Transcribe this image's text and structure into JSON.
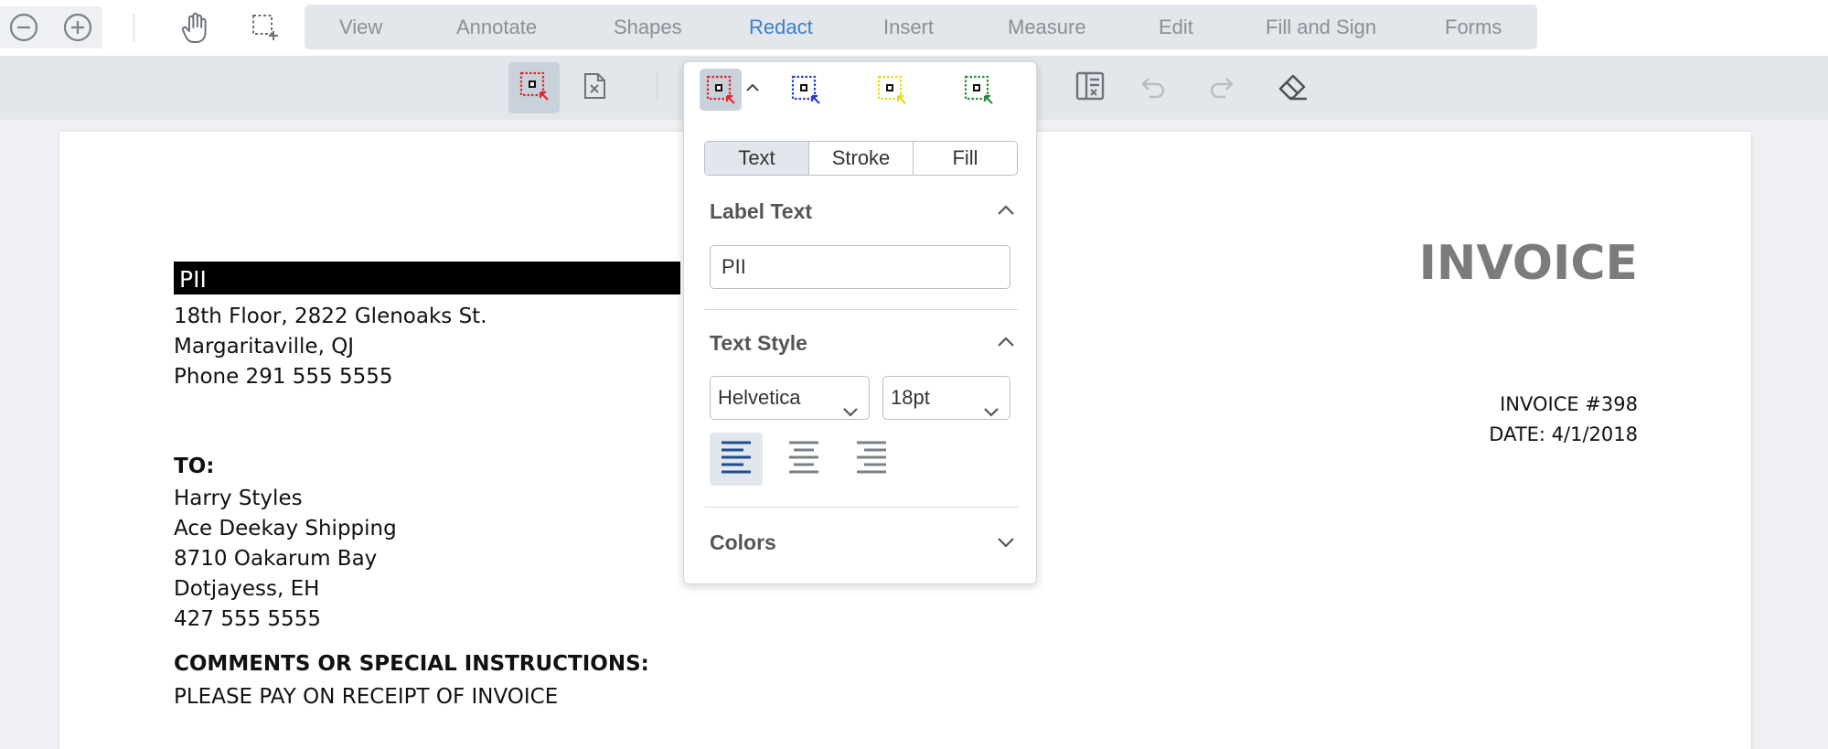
{
  "toolbar": {
    "icons": [
      "zoom-out-icon",
      "zoom-in-icon",
      "pan-hand-icon",
      "marquee-select-icon"
    ],
    "menu": [
      {
        "label": "View"
      },
      {
        "label": "Annotate"
      },
      {
        "label": "Shapes"
      },
      {
        "label": "Redact",
        "active": true
      },
      {
        "label": "Insert"
      },
      {
        "label": "Measure"
      },
      {
        "label": "Edit"
      },
      {
        "label": "Fill and Sign"
      },
      {
        "label": "Forms"
      }
    ]
  },
  "subtoolbar": {
    "icons": [
      "redact-area-icon",
      "redact-page-icon",
      "apply-redactions-icon",
      "undo-icon",
      "redo-icon",
      "eraser-icon"
    ],
    "active": "redact-area-icon"
  },
  "redact_popup": {
    "presets": [
      {
        "name": "red-redaction-preset",
        "color": "#e0282a",
        "active": true
      },
      {
        "name": "blue-redaction-preset",
        "color": "#2b3ad8"
      },
      {
        "name": "yellow-redaction-preset",
        "color": "#e8d820"
      },
      {
        "name": "green-redaction-preset",
        "color": "#2a8a3a"
      }
    ],
    "tabs": [
      {
        "label": "Text",
        "active": true
      },
      {
        "label": "Stroke"
      },
      {
        "label": "Fill"
      }
    ],
    "label_text_title": "Label Text",
    "label_text_value": "PII",
    "text_style_title": "Text Style",
    "font": "Helvetica",
    "size": "18pt",
    "alignment": "left",
    "colors_title": "Colors"
  },
  "document": {
    "redacted_label": "PII",
    "title": "INVOICE",
    "sender_lines": [
      "18th Floor, 2822 Glenoaks St.",
      "Margaritaville, QJ",
      "Phone 291 555 5555"
    ],
    "invoice_number": "INVOICE #398",
    "date": "DATE: 4/1/2018",
    "to_label": "TO:",
    "recipient_lines": [
      "Harry Styles",
      "Ace Deekay Shipping",
      "8710 Oakarum Bay",
      "Dotjayess, EH",
      "427 555 5555"
    ],
    "comments_label": "COMMENTS OR SPECIAL INSTRUCTIONS:",
    "comments_text": "PLEASE PAY ON RECEIPT OF INVOICE"
  }
}
